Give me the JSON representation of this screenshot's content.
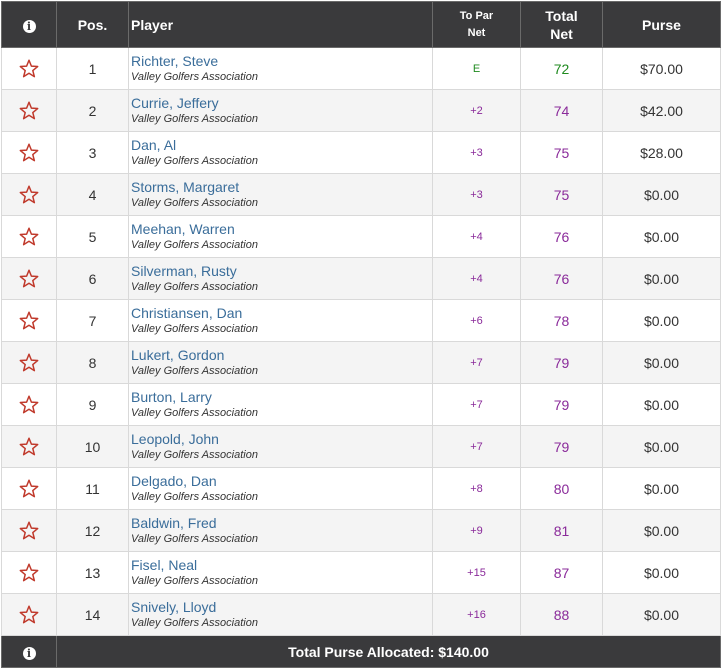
{
  "header": {
    "pos": "Pos.",
    "player": "Player",
    "to_par_line1": "To Par",
    "to_par_line2": "Net",
    "total_line1": "Total",
    "total_line2": "Net",
    "purse": "Purse"
  },
  "rows": [
    {
      "pos": "1",
      "name": "Richter, Steve",
      "org": "Valley Golfers Association",
      "to_par": "E",
      "net": "72",
      "purse": "$70.00"
    },
    {
      "pos": "2",
      "name": "Currie, Jeffery",
      "org": "Valley Golfers Association",
      "to_par": "+2",
      "net": "74",
      "purse": "$42.00"
    },
    {
      "pos": "3",
      "name": "Dan, Al",
      "org": "Valley Golfers Association",
      "to_par": "+3",
      "net": "75",
      "purse": "$28.00"
    },
    {
      "pos": "4",
      "name": "Storms, Margaret",
      "org": "Valley Golfers Association",
      "to_par": "+3",
      "net": "75",
      "purse": "$0.00"
    },
    {
      "pos": "5",
      "name": "Meehan, Warren",
      "org": "Valley Golfers Association",
      "to_par": "+4",
      "net": "76",
      "purse": "$0.00"
    },
    {
      "pos": "6",
      "name": "Silverman, Rusty",
      "org": "Valley Golfers Association",
      "to_par": "+4",
      "net": "76",
      "purse": "$0.00"
    },
    {
      "pos": "7",
      "name": "Christiansen, Dan",
      "org": "Valley Golfers Association",
      "to_par": "+6",
      "net": "78",
      "purse": "$0.00"
    },
    {
      "pos": "8",
      "name": "Lukert, Gordon",
      "org": "Valley Golfers Association",
      "to_par": "+7",
      "net": "79",
      "purse": "$0.00"
    },
    {
      "pos": "9",
      "name": "Burton, Larry",
      "org": "Valley Golfers Association",
      "to_par": "+7",
      "net": "79",
      "purse": "$0.00"
    },
    {
      "pos": "10",
      "name": "Leopold, John",
      "org": "Valley Golfers Association",
      "to_par": "+7",
      "net": "79",
      "purse": "$0.00"
    },
    {
      "pos": "11",
      "name": "Delgado, Dan",
      "org": "Valley Golfers Association",
      "to_par": "+8",
      "net": "80",
      "purse": "$0.00"
    },
    {
      "pos": "12",
      "name": "Baldwin, Fred",
      "org": "Valley Golfers Association",
      "to_par": "+9",
      "net": "81",
      "purse": "$0.00"
    },
    {
      "pos": "13",
      "name": "Fisel, Neal",
      "org": "Valley Golfers Association",
      "to_par": "+15",
      "net": "87",
      "purse": "$0.00"
    },
    {
      "pos": "14",
      "name": "Snively, Lloyd",
      "org": "Valley Golfers Association",
      "to_par": "+16",
      "net": "88",
      "purse": "$0.00"
    }
  ],
  "footer": {
    "total_purse": "Total Purse Allocated: $140.00"
  },
  "colors": {
    "header_bg": "#3a3a3c",
    "player_link": "#3a6d9a",
    "over_par": "#8a2a9a",
    "even_par": "#1f8a1f",
    "star": "#c0392b"
  },
  "icons": {
    "info": "info-icon",
    "favorite": "star-outline-icon"
  }
}
